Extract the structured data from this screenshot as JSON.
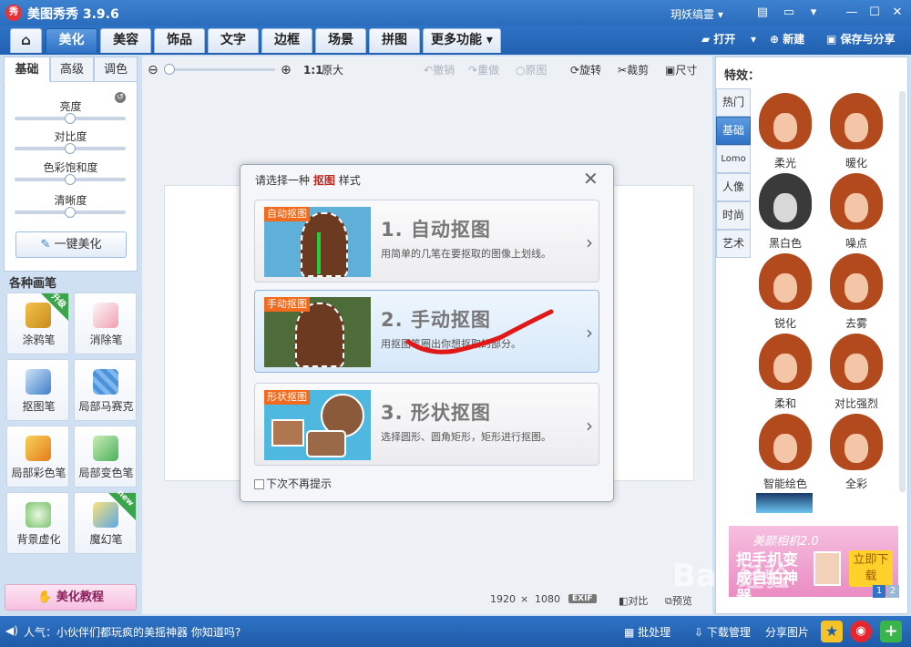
{
  "window": {
    "title": "美图秀秀 3.9.6",
    "logo": "秀",
    "user": "玥妖缟靈 ▾"
  },
  "nav": {
    "tabs": [
      "美化",
      "美容",
      "饰品",
      "文字",
      "边框",
      "场景",
      "拼图",
      "更多功能 ▾"
    ],
    "active": "美化",
    "open": "打开",
    "open_caret": "▾",
    "new": "新建",
    "save_share": "保存与分享"
  },
  "left_panel": {
    "tabs": [
      "基础",
      "高级",
      "调色"
    ],
    "sliders": [
      {
        "label": "亮度",
        "value": 0.5
      },
      {
        "label": "对比度",
        "value": 0.5
      },
      {
        "label": "色彩饱和度",
        "value": 0.5
      },
      {
        "label": "清晰度",
        "value": 0.5
      }
    ],
    "one_click": "一键美化",
    "brushes_title": "各种画笔",
    "tools": [
      {
        "label": "涂鸦笔",
        "badge": "升级"
      },
      {
        "label": "消除笔"
      },
      {
        "label": "抠图笔"
      },
      {
        "label": "局部马赛克"
      },
      {
        "label": "局部彩色笔"
      },
      {
        "label": "局部变色笔"
      },
      {
        "label": "背景虚化"
      },
      {
        "label": "魔幻笔",
        "badge": "new"
      }
    ],
    "tutorial": "美化教程"
  },
  "canvas_toolbar": {
    "zoom_ratio": "1:1",
    "original_size": "原大",
    "undo": "撤销",
    "redo": "重做",
    "original": "原图",
    "rotate": "旋转",
    "crop": "裁剪",
    "size": "尺寸"
  },
  "dialog": {
    "title_prefix": "请选择一种",
    "title_highlight": "抠图",
    "title_suffix": "样式",
    "options": [
      {
        "tag": "自动抠图",
        "title": "1. 自动抠图",
        "desc": "用简单的几笔在要抠取的图像上划线。"
      },
      {
        "tag": "手动抠图",
        "title": "2. 手动抠图",
        "desc": "用抠图笔圈出你想抠取的部分。"
      },
      {
        "tag": "形状抠图",
        "title": "3. 形状抠图",
        "desc": "选择圆形、圆角矩形，矩形进行抠图。"
      }
    ],
    "dont_show": "下次不再提示"
  },
  "canvas_status": {
    "width": "1920",
    "times": "×",
    "height": "1080",
    "exif": "EXIF",
    "compare": "对比",
    "preview": "预览"
  },
  "right_panel": {
    "title": "特效：",
    "tabs": [
      "热门",
      "基础",
      "Lomo",
      "人像",
      "时尚",
      "艺术"
    ],
    "active_tab": "基础",
    "effects": [
      "柔光",
      "暖化",
      "黑白色",
      "噪点",
      "锐化",
      "去雾",
      "柔和",
      "对比强烈",
      "智能绘色",
      "全彩"
    ],
    "ad_title": "美颜相机2.0",
    "ad_text": "把手机变成自拍神器",
    "ad_button": "立即下载",
    "pages": [
      "1",
      "2"
    ]
  },
  "statusbar": {
    "message": "人气：小伙伴们都玩疯的美摇神器 你知道吗?",
    "batch": "批处理",
    "download": "下载管理",
    "share": "分享图片"
  },
  "watermark": "Bai 经验 jingyan.baidu.com",
  "colors": {
    "accent": "#2f73c6",
    "highlight": "#c0271f",
    "tag": "#f26a1e",
    "annotation": "#e01818"
  }
}
